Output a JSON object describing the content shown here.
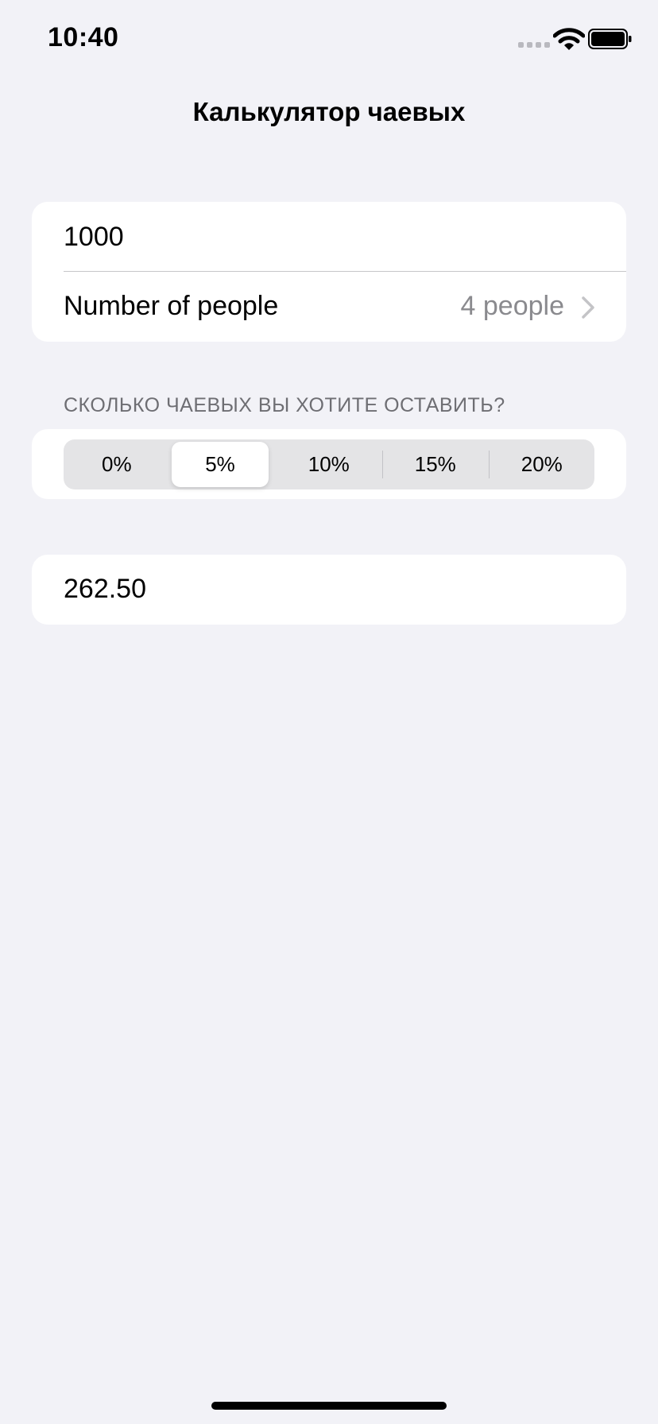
{
  "status_bar": {
    "time": "10:40"
  },
  "nav": {
    "title": "Калькулятор чаевых"
  },
  "form": {
    "amount_value": "1000",
    "people_label": "Number of people",
    "people_value": "4 people"
  },
  "tip_section": {
    "header": "СКОЛЬКО ЧАЕВЫХ ВЫ ХОТИТЕ ОСТАВИТЬ?",
    "options": [
      "0%",
      "5%",
      "10%",
      "15%",
      "20%"
    ],
    "selected": "5%"
  },
  "result": {
    "value": "262.50"
  },
  "colors": {
    "background": "#f2f2f7",
    "card": "#ffffff",
    "secondary_text": "#8a8a8e",
    "segment_track": "#e4e4e6"
  }
}
